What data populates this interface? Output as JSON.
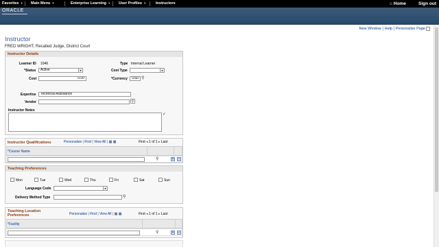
{
  "topbar": {
    "menus": [
      {
        "label": "Favorites"
      },
      {
        "label": "Main Menu"
      },
      {
        "label": "Enterprise Learning"
      },
      {
        "label": "User Profiles"
      },
      {
        "label": "Instructors"
      }
    ],
    "home": "Home",
    "signout": "Sign out"
  },
  "brand": {
    "logo": "ORACLE"
  },
  "pagelinks": {
    "new_window": "New Window",
    "help": "Help",
    "personalize_page": "Personalize Page",
    "sep": "|"
  },
  "page": {
    "title": "Instructor",
    "subtitle": "FRED WRIGHT, Recalled Judge, District Court"
  },
  "details": {
    "header": "Instructor Details",
    "learner_id_label": "Learner ID",
    "learner_id": "1046",
    "type_label": "Type",
    "type_value": "Internal Learner",
    "status_label": "*Status",
    "status_value": "Active",
    "cost_type_label": "Cost Type",
    "cost_type_value": "",
    "cost_label": "Cost",
    "cost_value": "0.00",
    "currency_label": "*Currency",
    "currency_value": "USD",
    "expertise_label": "Expertise",
    "expertise_value": "Technical Assistance",
    "vendor_label": "Vendor",
    "vendor_value": "",
    "notes_label": "Instructor Notes"
  },
  "qualifications": {
    "header": "Instructor Qualifications",
    "personalize": "Personalize",
    "find": "Find",
    "view_all": "View All",
    "sep": "|",
    "first": "First",
    "range": "1 of 1",
    "last": "Last",
    "column": "*Course Name"
  },
  "teaching": {
    "header": "Teaching Preferences",
    "days": [
      "Mon",
      "Tue",
      "Wed",
      "Thu",
      "Fri",
      "Sat",
      "Sun"
    ],
    "language_label": "Language Code",
    "delivery_label": "Delivery Method Type"
  },
  "location": {
    "header_line1": "Teaching Location",
    "header_line2": "Preferences",
    "personalize": "Personalize",
    "find": "Find",
    "view_all": "View All",
    "sep": "|",
    "first": "First",
    "range": "1 of 1",
    "last": "Last",
    "column": "*Facility"
  },
  "icons": {
    "dropdown": "▾",
    "lookup": "⚲",
    "prev": "◂",
    "next": "▸",
    "add": "+",
    "remove": "−",
    "grid": "▦",
    "spell": "✓",
    "home": "⌂"
  },
  "colors": {
    "topbar": "#000000",
    "banner": "#3e5a79",
    "section_header": "#8a3a0c",
    "title": "#3a5e9e",
    "link": "#00359c"
  }
}
